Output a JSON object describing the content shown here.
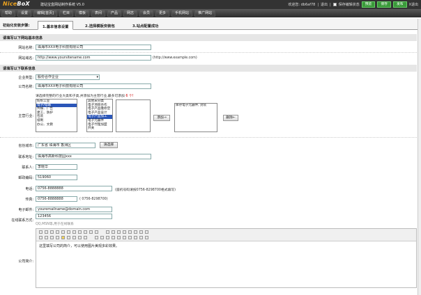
{
  "app": {
    "logo_a": "Nice",
    "logo_b": "BoX",
    "title": "建站宝盒网站制作系统 V5.0"
  },
  "top": {
    "welcome": "欢迎您: db6af78",
    "logout": "退出",
    "keep_label": "保存编辑状态",
    "btn_preview": "预览",
    "btn_save": "保存",
    "btn_publish": "发布",
    "btn_exit": "X退出"
  },
  "nav": [
    "帮助",
    "设置",
    "编辑[首页]",
    "栏目",
    "模板",
    "表间",
    "产品",
    "网志",
    "会员",
    "更多",
    "手机网站",
    "推广网站"
  ],
  "steps": {
    "label": "初始化安装步骤:",
    "s1": "1.基本信息设置",
    "s2": "2.选择模板安装包",
    "s3": "3.站点配置成功"
  },
  "site": {
    "heading": "请填写以下网站基本信息",
    "name_label": "网站名称:",
    "name_value": "珠海市XXX电子科技有限公司",
    "domain_label": "网站域名:",
    "domain_value": "http://www.yoursitename.com",
    "domain_hint": "(http://www.example.com)"
  },
  "company": {
    "heading": "请填写以下联系信息",
    "type_label": "企业类型:",
    "type_value": "股份合作企业",
    "cname_label": "公司名称:",
    "cname_value": "珠海市XXX电子科技有限公司",
    "industry_label": "主营行业:",
    "industry_hint": "请选择完整的行业大类和子类,并添加为主营行业,最多可添加",
    "industry_max": "6 个!",
    "cat_list": [
      "纺织工业",
      "电子/电器",
      "传媒、广告",
      "建工、防护",
      "包装",
      "纸制",
      "办公、文教"
    ],
    "sub_list": [
      "其他未分类",
      "电子项目合作",
      "电子产品维修空",
      "电子产品设计",
      "电子产品加工",
      "电子元器件",
      "电子代理加盟",
      "开关"
    ],
    "add_btn": "添加→",
    "selected": "库存电子元器件, 封装",
    "del_btn": "删除←",
    "city_label": "省份城市:",
    "city_value": "广东省 珠海市 香洲区",
    "city_btn": "请选择",
    "addr_label": "联系地址:",
    "addr_value": "珠海市高新科技园xxx",
    "contact_label": "联系人:",
    "contact_value": "李晓华",
    "zip_label": "邮政编码:",
    "zip_value": "519060",
    "phone_label": "电话:",
    "phone_value": "0756-8888888",
    "phone_hint": "(座机号码请按0756-8298700格式填写)",
    "fax_label": "传真:",
    "fax_value": "0756-8888888",
    "fax_hint": "( 0756-8298700)",
    "email_label": "电子邮件:",
    "email_value": "youremailname@domain.com",
    "im_label": "在线联系方式:",
    "im_value": "123456",
    "im_hint": "QQ,MSN等,用于在线联系",
    "intro_label": "公司简介:",
    "intro_text": "这里填写公司的简介，可以使用图片美观多彩效果。"
  },
  "colors": {
    "topbar": "#333333",
    "nav": "#3b3b3b",
    "accent": "#3a9a3a",
    "logo": "#e8a020"
  }
}
